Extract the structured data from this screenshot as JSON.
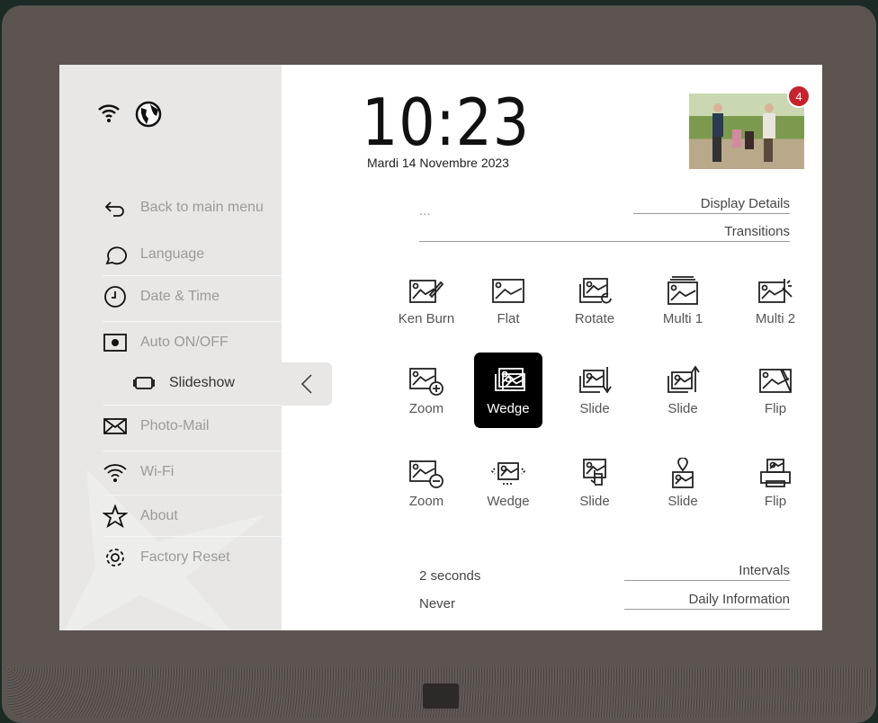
{
  "status": {
    "icons": [
      "wifi-icon",
      "globe-icon"
    ]
  },
  "clock": {
    "time": "10:23",
    "date": "Mardi 14 Novembre 2023"
  },
  "notification": {
    "count": "4",
    "color": "#c8232c"
  },
  "menu": [
    {
      "label": "Back to main menu",
      "icon": "back-arrow-icon"
    },
    {
      "label": "Language",
      "icon": "speech-bubble-icon"
    },
    {
      "label": "Date & Time",
      "icon": "clock-icon"
    },
    {
      "label": "Auto ON/OFF",
      "icon": "screen-power-icon"
    },
    {
      "label": "Slideshow",
      "icon": "slideshow-icon",
      "active": true
    },
    {
      "label": "Photo-Mail",
      "icon": "envelope-icon"
    },
    {
      "label": "Wi-Fi",
      "icon": "wifi-icon"
    },
    {
      "label": "About",
      "icon": "star-icon"
    },
    {
      "label": "Factory Reset",
      "icon": "gear-reset-icon"
    }
  ],
  "settings": {
    "display_details": {
      "label": "Display Details",
      "value": "..."
    },
    "transitions": {
      "label": "Transitions"
    },
    "intervals": {
      "label": "Intervals",
      "value": "2 seconds"
    },
    "daily_information": {
      "label": "Daily Information",
      "value": "Never"
    }
  },
  "transitions": [
    {
      "label": "Ken Burn",
      "icon": "image-pencil-icon"
    },
    {
      "label": "Flat",
      "icon": "image-icon"
    },
    {
      "label": "Rotate",
      "icon": "image-rotate-icon"
    },
    {
      "label": "Multi 1",
      "icon": "image-stack-icon"
    },
    {
      "label": "Multi 2",
      "icon": "image-magic-icon"
    },
    {
      "label": "Zoom",
      "icon": "image-zoom-in-icon"
    },
    {
      "label": "Wedge",
      "icon": "image-overlap-icon",
      "selected": true
    },
    {
      "label": "Slide",
      "icon": "image-slide-down-icon"
    },
    {
      "label": "Slide",
      "icon": "image-slide-up-icon"
    },
    {
      "label": "Flip",
      "icon": "image-flip-icon"
    },
    {
      "label": "Zoom",
      "icon": "image-zoom-out-icon"
    },
    {
      "label": "Wedge",
      "icon": "image-carousel-icon"
    },
    {
      "label": "Slide",
      "icon": "image-touch-icon"
    },
    {
      "label": "Slide",
      "icon": "image-pin-icon"
    },
    {
      "label": "Flip",
      "icon": "image-print-icon"
    }
  ]
}
